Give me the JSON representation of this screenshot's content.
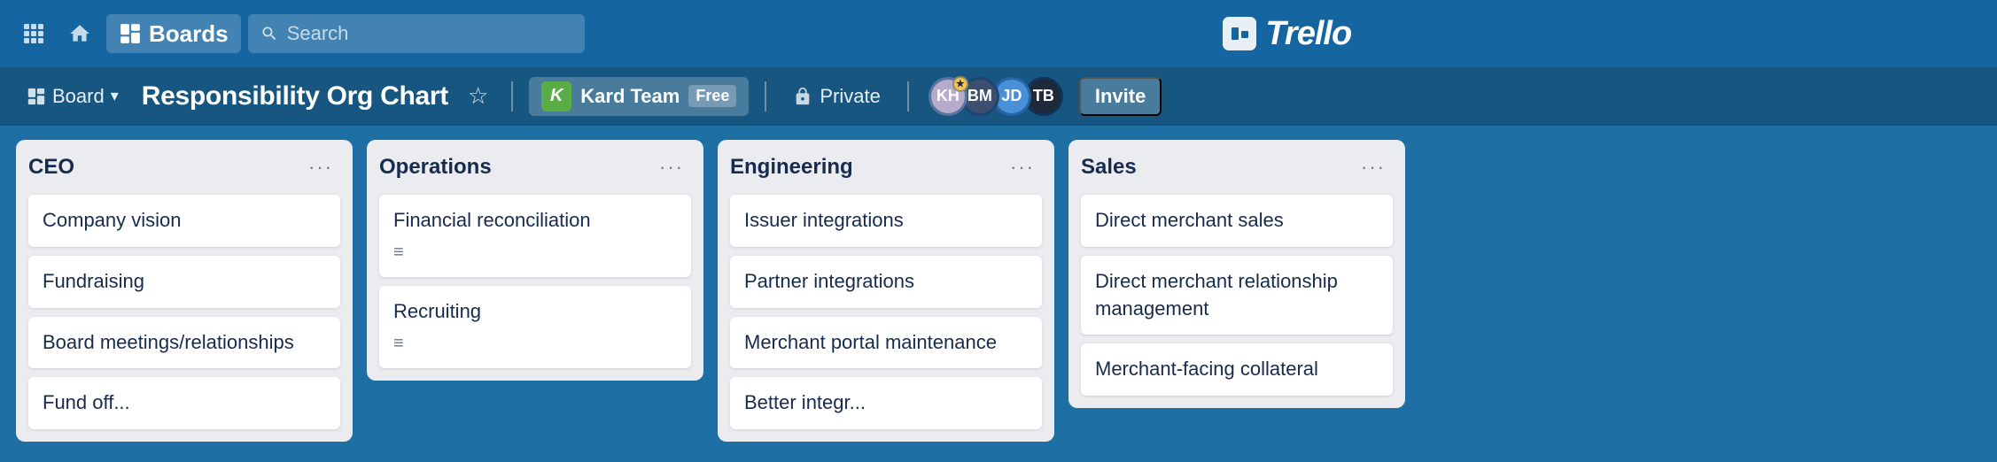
{
  "nav": {
    "boards_label": "Boards",
    "search_placeholder": "Search",
    "trello_label": "Trello"
  },
  "board_bar": {
    "board_label": "Board",
    "title": "Responsibility Org Chart",
    "team_name": "Kard Team",
    "team_icon_letter": "K",
    "free_badge": "Free",
    "private_label": "Private",
    "invite_label": "Invite",
    "avatars": [
      {
        "initials": "KH",
        "color": "#b4acca",
        "has_star": true
      },
      {
        "initials": "BM",
        "color": "#3d4f6e"
      },
      {
        "initials": "JD",
        "color": "#4a90d9"
      },
      {
        "initials": "TB",
        "color": "#1e2a3a"
      }
    ]
  },
  "lists": [
    {
      "id": "ceo",
      "title": "CEO",
      "cards": [
        {
          "text": "Company vision",
          "has_description": false
        },
        {
          "text": "Fundraising",
          "has_description": false
        },
        {
          "text": "Board meetings/relationships",
          "has_description": false
        },
        {
          "text": "Fund off...",
          "has_description": false
        }
      ]
    },
    {
      "id": "operations",
      "title": "Operations",
      "cards": [
        {
          "text": "Financial reconciliation",
          "has_description": true
        },
        {
          "text": "Recruiting",
          "has_description": true
        }
      ]
    },
    {
      "id": "engineering",
      "title": "Engineering",
      "cards": [
        {
          "text": "Issuer integrations",
          "has_description": false
        },
        {
          "text": "Partner integrations",
          "has_description": false
        },
        {
          "text": "Merchant portal maintenance",
          "has_description": false
        },
        {
          "text": "Better integr...",
          "has_description": false
        }
      ]
    },
    {
      "id": "sales",
      "title": "Sales",
      "cards": [
        {
          "text": "Direct merchant sales",
          "has_description": false
        },
        {
          "text": "Direct merchant relationship management",
          "has_description": false
        },
        {
          "text": "Merchant-facing collateral",
          "has_description": false
        }
      ]
    }
  ],
  "icons": {
    "apps": "⋮⋮",
    "home": "⌂",
    "boards": "▦",
    "board_view": "▦",
    "chevron_down": "▾",
    "search": "🔍",
    "star": "☆",
    "lock": "🔒",
    "ellipsis": "···",
    "description": "≡"
  }
}
